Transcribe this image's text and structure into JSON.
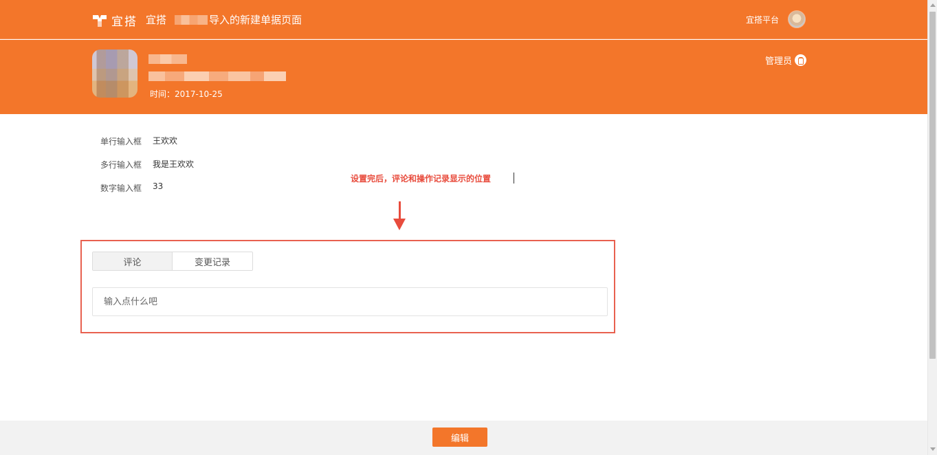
{
  "header": {
    "logo_text": "宜搭",
    "page_title_suffix": "导入的新建单据页面",
    "platform_link": "宜搭平台",
    "user_avatar_icon": "user-avatar-icon"
  },
  "hero": {
    "time_text": "时间：2017-10-25",
    "role_label": "管理员",
    "role_icon": "switch-icon",
    "background_color": "#f3762a"
  },
  "form": {
    "fields": [
      {
        "label": "单行输入框",
        "value": "王欢欢"
      },
      {
        "label": "多行输入框",
        "value": "我是王欢欢"
      },
      {
        "label": "数字输入框",
        "value": "33"
      }
    ]
  },
  "annotation": {
    "text": "设置完后，评论和操作记录显示的位置",
    "color": "#e84c3d",
    "arrow_icon": "down-arrow-icon"
  },
  "comments": {
    "tabs": [
      {
        "label": "评论",
        "active": true
      },
      {
        "label": "变更记录",
        "active": false
      }
    ],
    "input_placeholder": "输入点什么吧"
  },
  "footer": {
    "edit_button_label": "编辑"
  }
}
